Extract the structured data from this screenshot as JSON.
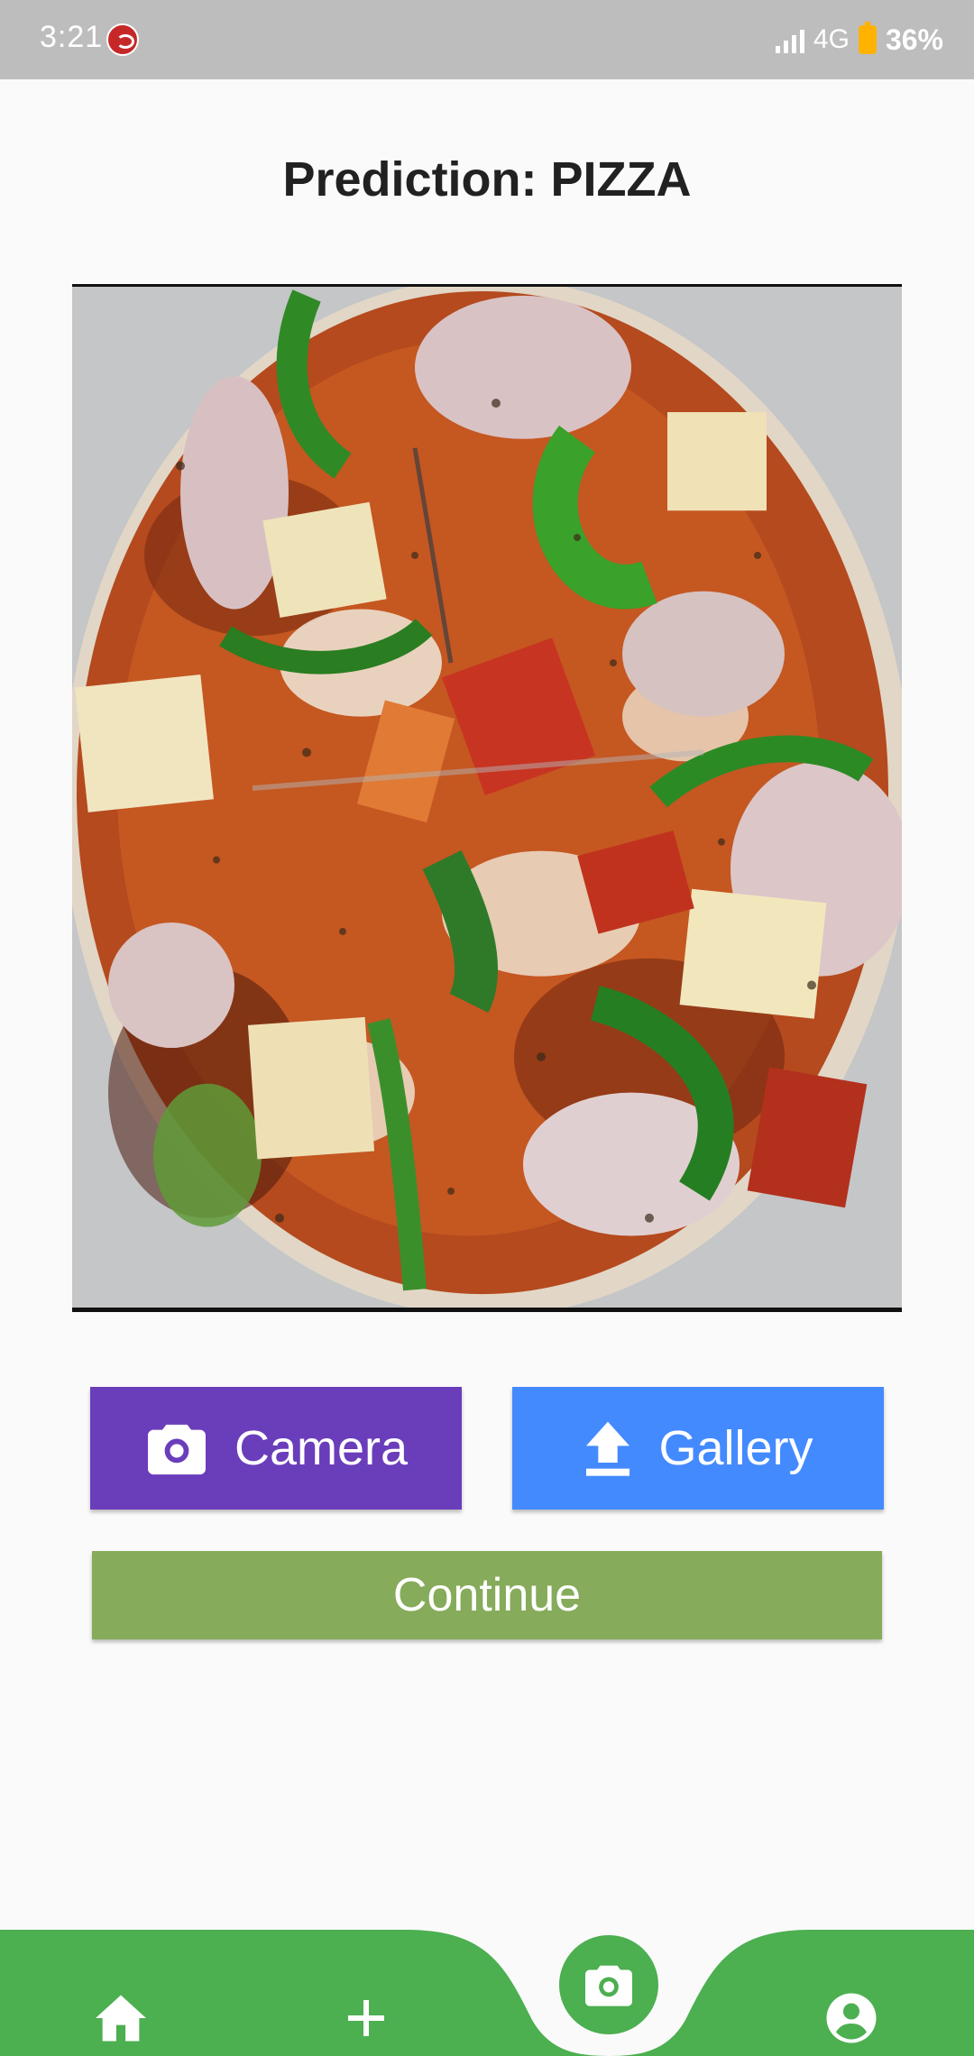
{
  "status_bar": {
    "time": "3:21",
    "network": "4G",
    "battery": "36%"
  },
  "page": {
    "title": "Prediction: PIZZA"
  },
  "buttons": {
    "camera_label": "Camera",
    "gallery_label": "Gallery",
    "continue_label": "Continue"
  },
  "bottom_nav": {
    "items": [
      "home-icon",
      "add-icon",
      "camera-icon",
      "account-circle-icon"
    ]
  },
  "colors": {
    "status_bar": "#bdbdbd",
    "camera_button": "#6a3dbb",
    "gallery_button": "#448aff",
    "continue_button": "#86ab5a",
    "nav_bar": "#4caf50"
  }
}
